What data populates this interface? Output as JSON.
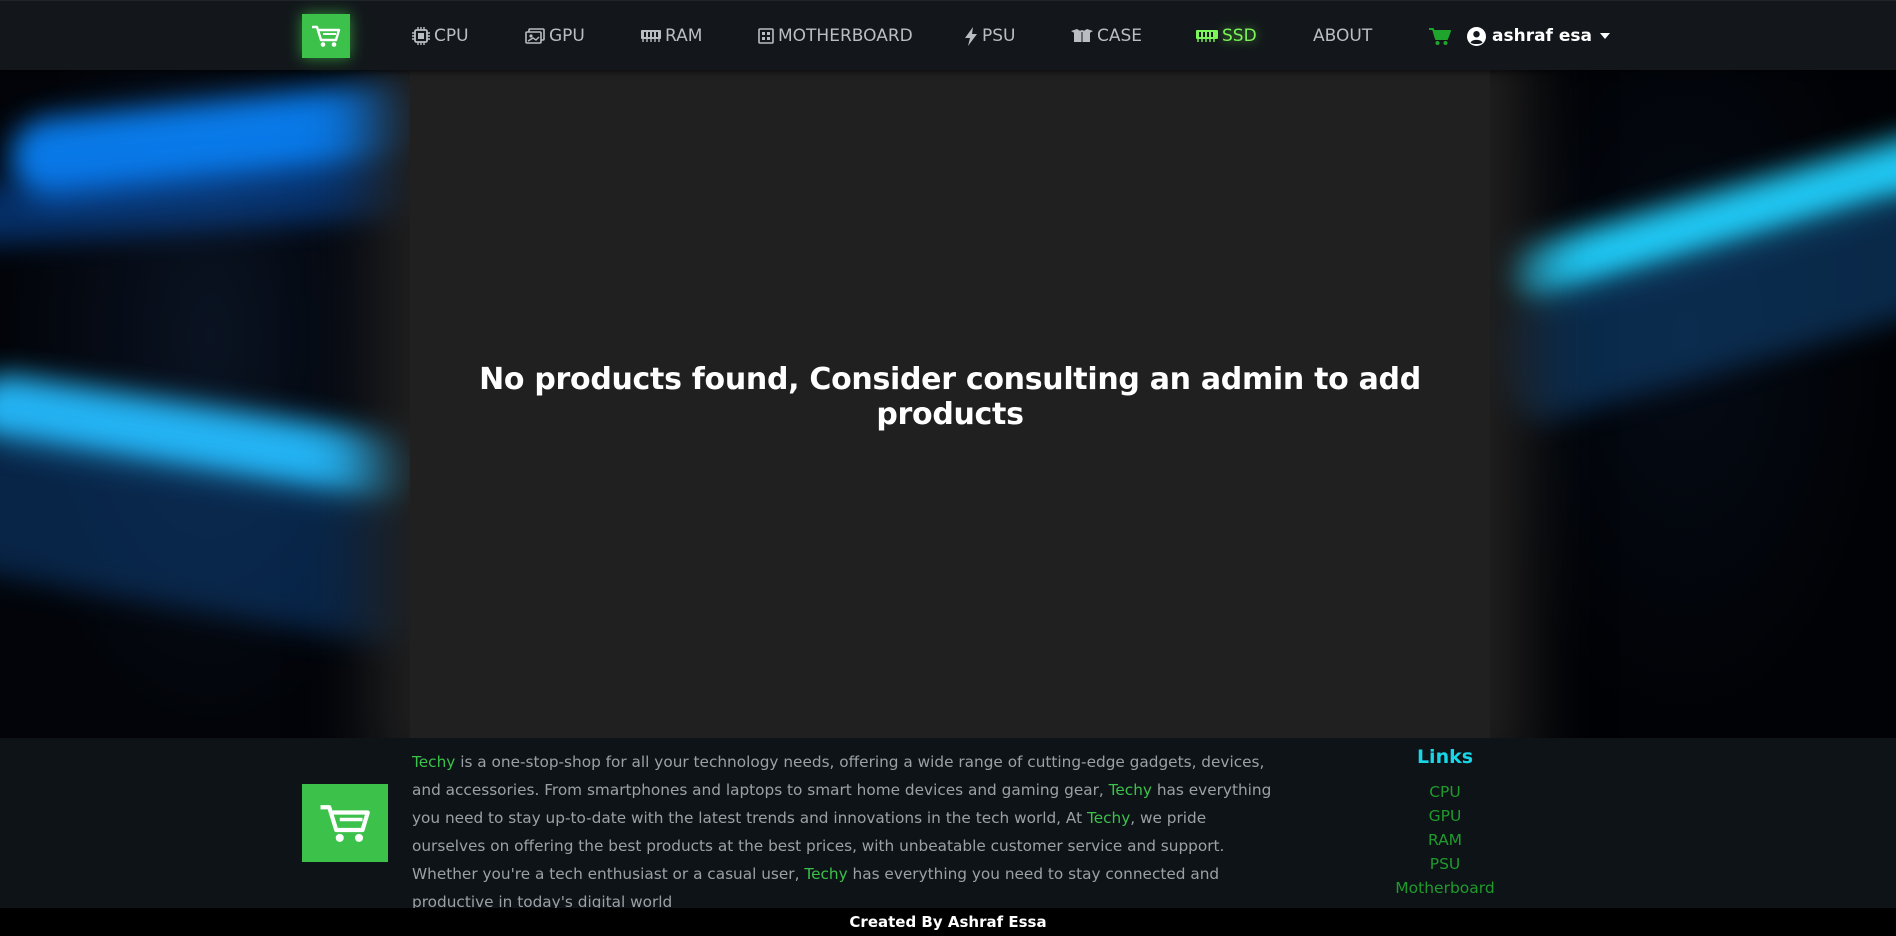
{
  "nav": {
    "logo_icon": "shopping-cart-icon",
    "items": [
      {
        "label": "CPU",
        "icon": "cpu-icon"
      },
      {
        "label": "GPU",
        "icon": "gpu-icon"
      },
      {
        "label": "RAM",
        "icon": "ram-icon"
      },
      {
        "label": "MOTHERBOARD",
        "icon": "motherboard-icon"
      },
      {
        "label": "PSU",
        "icon": "bolt-icon"
      },
      {
        "label": "CASE",
        "icon": "box-icon"
      },
      {
        "label": "SSD",
        "icon": "memory-icon",
        "active": true
      },
      {
        "label": "ABOUT"
      }
    ],
    "cart_icon": "cart-icon",
    "user": {
      "name": "ashraf esa",
      "icon": "user-circle-icon"
    }
  },
  "hero": {
    "message": "No products found, Consider consulting an admin to add products"
  },
  "footer": {
    "logo_icon": "shopping-cart-icon",
    "description": {
      "brand": "Techy",
      "part1": " is a one-stop-shop for all your technology needs, offering a wide range of cutting-edge gadgets, devices, and accessories. From smartphones and laptops to smart home devices and gaming gear, ",
      "part2": " has everything you need to stay up-to-date with the latest trends and innovations in the tech world, At ",
      "part3": ", we pride ourselves on offering the best products at the best prices, with unbeatable customer service and support. Whether you're a tech enthusiast or a casual user, ",
      "part4": " has everything you need to stay connected and productive in today's digital world"
    },
    "links_title": "Links",
    "links": [
      "CPU",
      "GPU",
      "RAM",
      "PSU",
      "Motherboard"
    ]
  },
  "bottom_bar": {
    "credit": "Created By Ashraf Essa"
  },
  "colors": {
    "accent_green": "#3cc14a",
    "active_nav": "#7cf55a",
    "links_title": "#17d6e8",
    "link_text": "#1f9b2d",
    "hero_panel": "#202020",
    "navbar_bg": "#13171b"
  }
}
